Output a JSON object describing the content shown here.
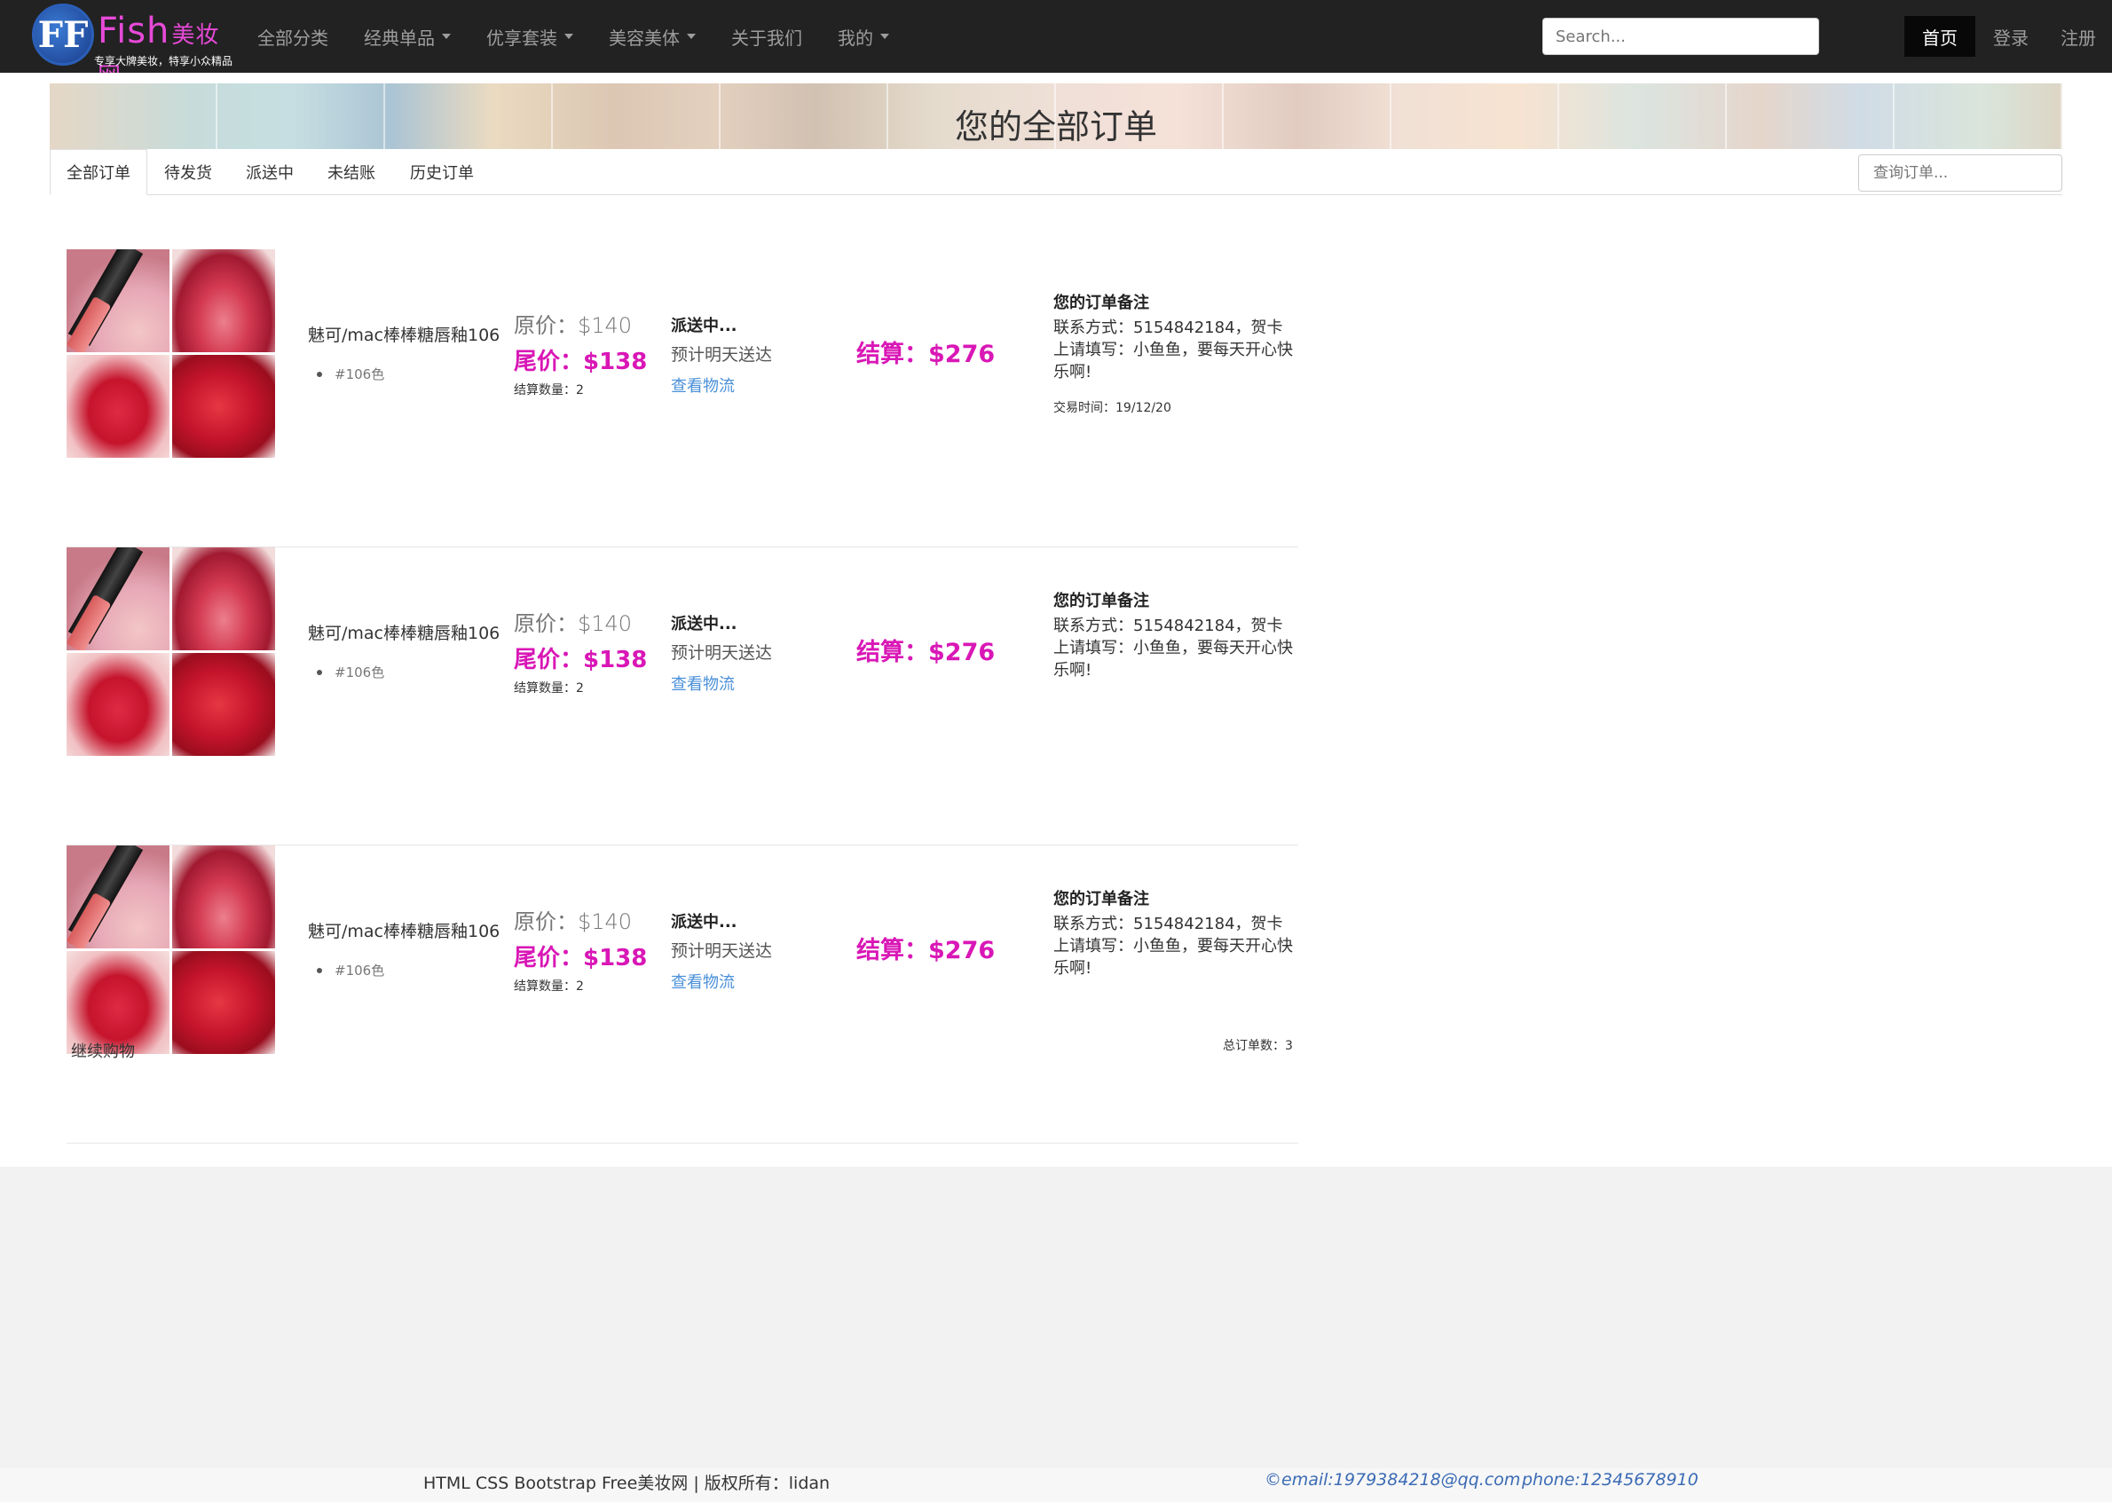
{
  "brand": {
    "logo_mark": "FF",
    "name": "Fish",
    "name_suffix": "美妆网",
    "slogan": "专享大牌美妆，特享小众精品"
  },
  "nav": {
    "items": [
      {
        "label": "全部分类",
        "dropdown": false
      },
      {
        "label": "经典单品",
        "dropdown": true
      },
      {
        "label": "优享套装",
        "dropdown": true
      },
      {
        "label": "美容美体",
        "dropdown": true
      },
      {
        "label": "关于我们",
        "dropdown": false
      },
      {
        "label": "我的",
        "dropdown": true
      }
    ],
    "search_placeholder": "Search...",
    "right": [
      {
        "label": "首页",
        "active": true
      },
      {
        "label": "登录",
        "active": false
      },
      {
        "label": "注册",
        "active": false
      }
    ]
  },
  "page": {
    "banner_title": "您的全部订单",
    "tabs": [
      "全部订单",
      "待发货",
      "派送中",
      "未结账",
      "历史订单"
    ],
    "active_tab": 0,
    "order_search_placeholder": "查询订单..."
  },
  "orders": [
    {
      "product_name": "魅可/mac棒棒糖唇釉106",
      "spec": "#106色",
      "original_price": "原价：$140",
      "final_price": "尾价：$138",
      "quantity": "结算数量：2",
      "status": "派送中...",
      "eta": "预计明天送达",
      "logistics_link": "查看物流",
      "settlement": "结算：$276",
      "note_title": "您的订单备注",
      "note_text": "联系方式：5154842184，贺卡上请填写：小鱼鱼，要每天开心快乐啊!",
      "trade_time": "交易时间：19/12/20"
    },
    {
      "product_name": "魅可/mac棒棒糖唇釉106",
      "spec": "#106色",
      "original_price": "原价：$140",
      "final_price": "尾价：$138",
      "quantity": "结算数量：2",
      "status": "派送中...",
      "eta": "预计明天送达",
      "logistics_link": "查看物流",
      "settlement": "结算：$276",
      "note_title": "您的订单备注",
      "note_text": "联系方式：5154842184，贺卡上请填写：小鱼鱼，要每天开心快乐啊!",
      "trade_time": ""
    },
    {
      "product_name": "魅可/mac棒棒糖唇釉106",
      "spec": "#106色",
      "original_price": "原价：$140",
      "final_price": "尾价：$138",
      "quantity": "结算数量：2",
      "status": "派送中...",
      "eta": "预计明天送达",
      "logistics_link": "查看物流",
      "settlement": "结算：$276",
      "note_title": "您的订单备注",
      "note_text": "联系方式：5154842184，贺卡上请填写：小鱼鱼，要每天开心快乐啊!",
      "trade_time": ""
    }
  ],
  "summary": {
    "continue_shopping": "继续购物",
    "total_orders": "总订单数：3"
  },
  "footer": {
    "copyright": "HTML CSS Bootstrap Free美妆网 | 版权所有：lidan",
    "email": "©email:1979384218@qq.com",
    "phone": "phone:12345678910"
  },
  "colors": {
    "accent_price": "#d917b6",
    "link": "#4a90d9",
    "navbar_bg": "#222222",
    "brand": "#e74ad8"
  }
}
